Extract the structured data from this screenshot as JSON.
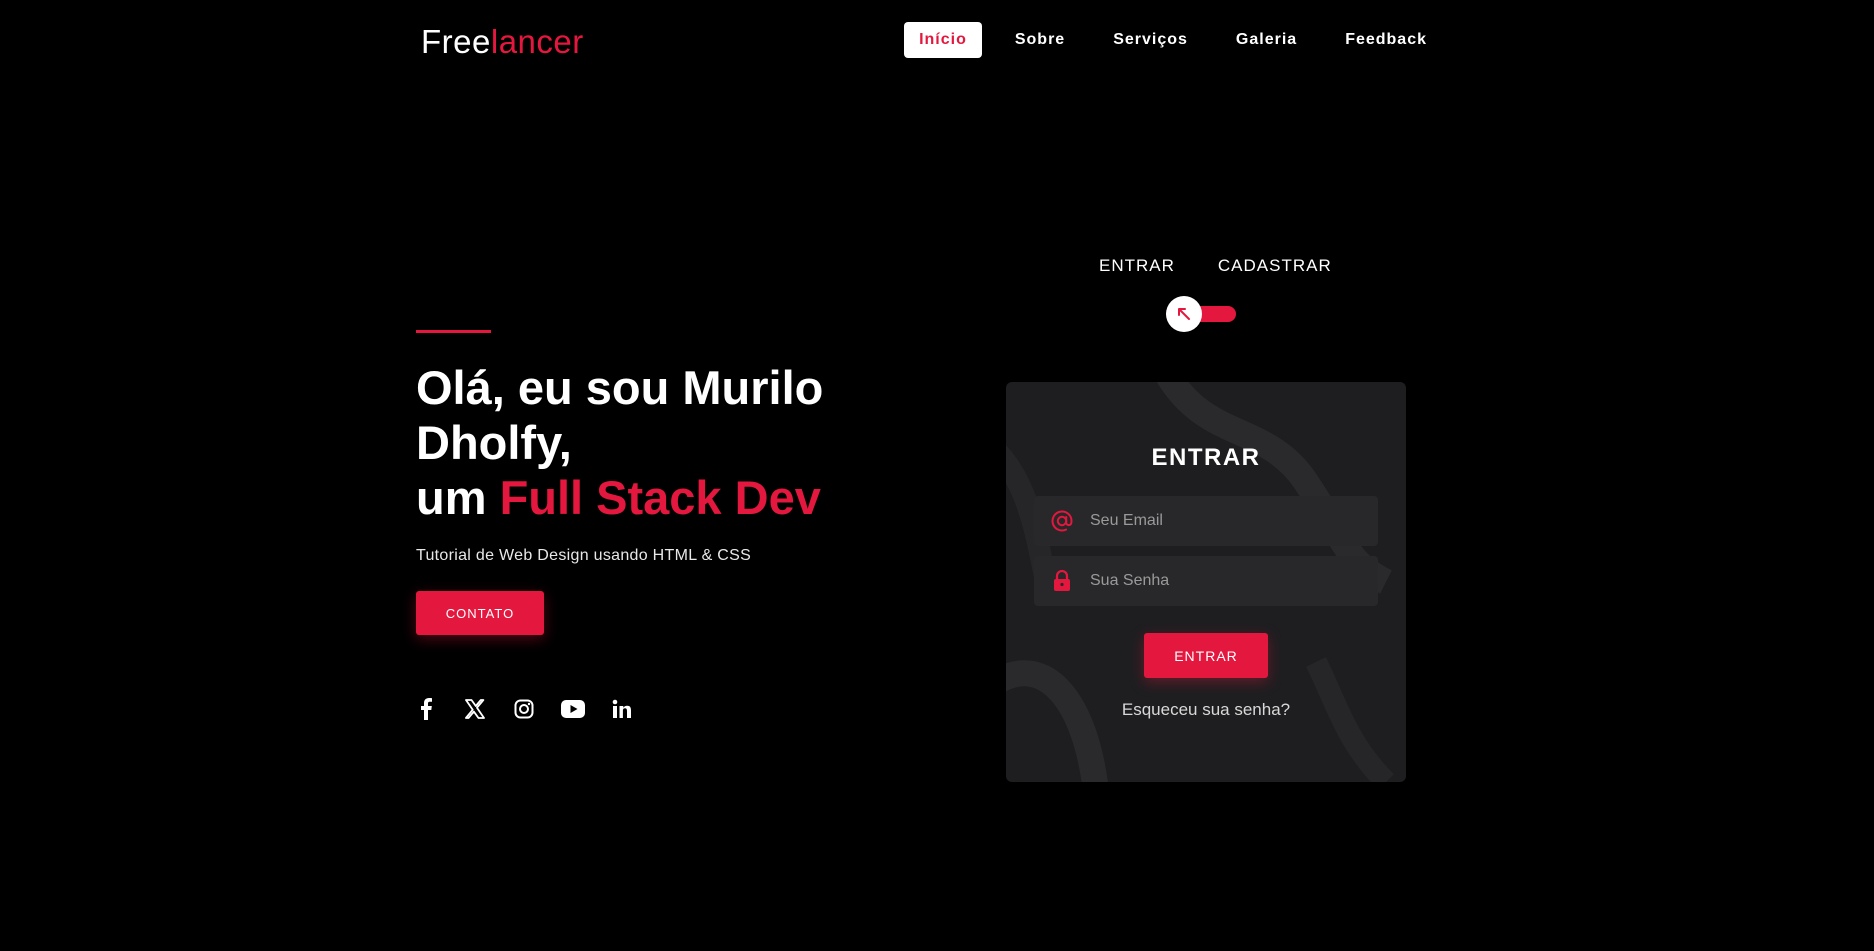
{
  "header": {
    "logo_main": "Free",
    "logo_accent": "lancer",
    "nav": [
      {
        "label": "Início",
        "active": true
      },
      {
        "label": "Sobre",
        "active": false
      },
      {
        "label": "Serviços",
        "active": false
      },
      {
        "label": "Galeria",
        "active": false
      },
      {
        "label": "Feedback",
        "active": false
      }
    ]
  },
  "hero": {
    "title_line1": "Olá, eu sou Murilo Dholfy,",
    "title_prefix": "um ",
    "title_accent": "Full Stack Dev",
    "subtitle": "Tutorial de Web Design usando HTML & CSS",
    "contact_label": "CONTATO",
    "socials": [
      "facebook-icon",
      "x-icon",
      "instagram-icon",
      "youtube-icon",
      "linkedin-icon"
    ]
  },
  "auth_toggle": {
    "login_label": "ENTRAR",
    "signup_label": "CADASTRAR"
  },
  "login_card": {
    "title": "ENTRAR",
    "email_placeholder": "Seu Email",
    "password_placeholder": "Sua Senha",
    "submit_label": "ENTRAR",
    "forgot_label": "Esqueceu sua senha?"
  },
  "colors": {
    "accent": "#e4173e",
    "background": "#000000",
    "card": "#1e1e20"
  }
}
